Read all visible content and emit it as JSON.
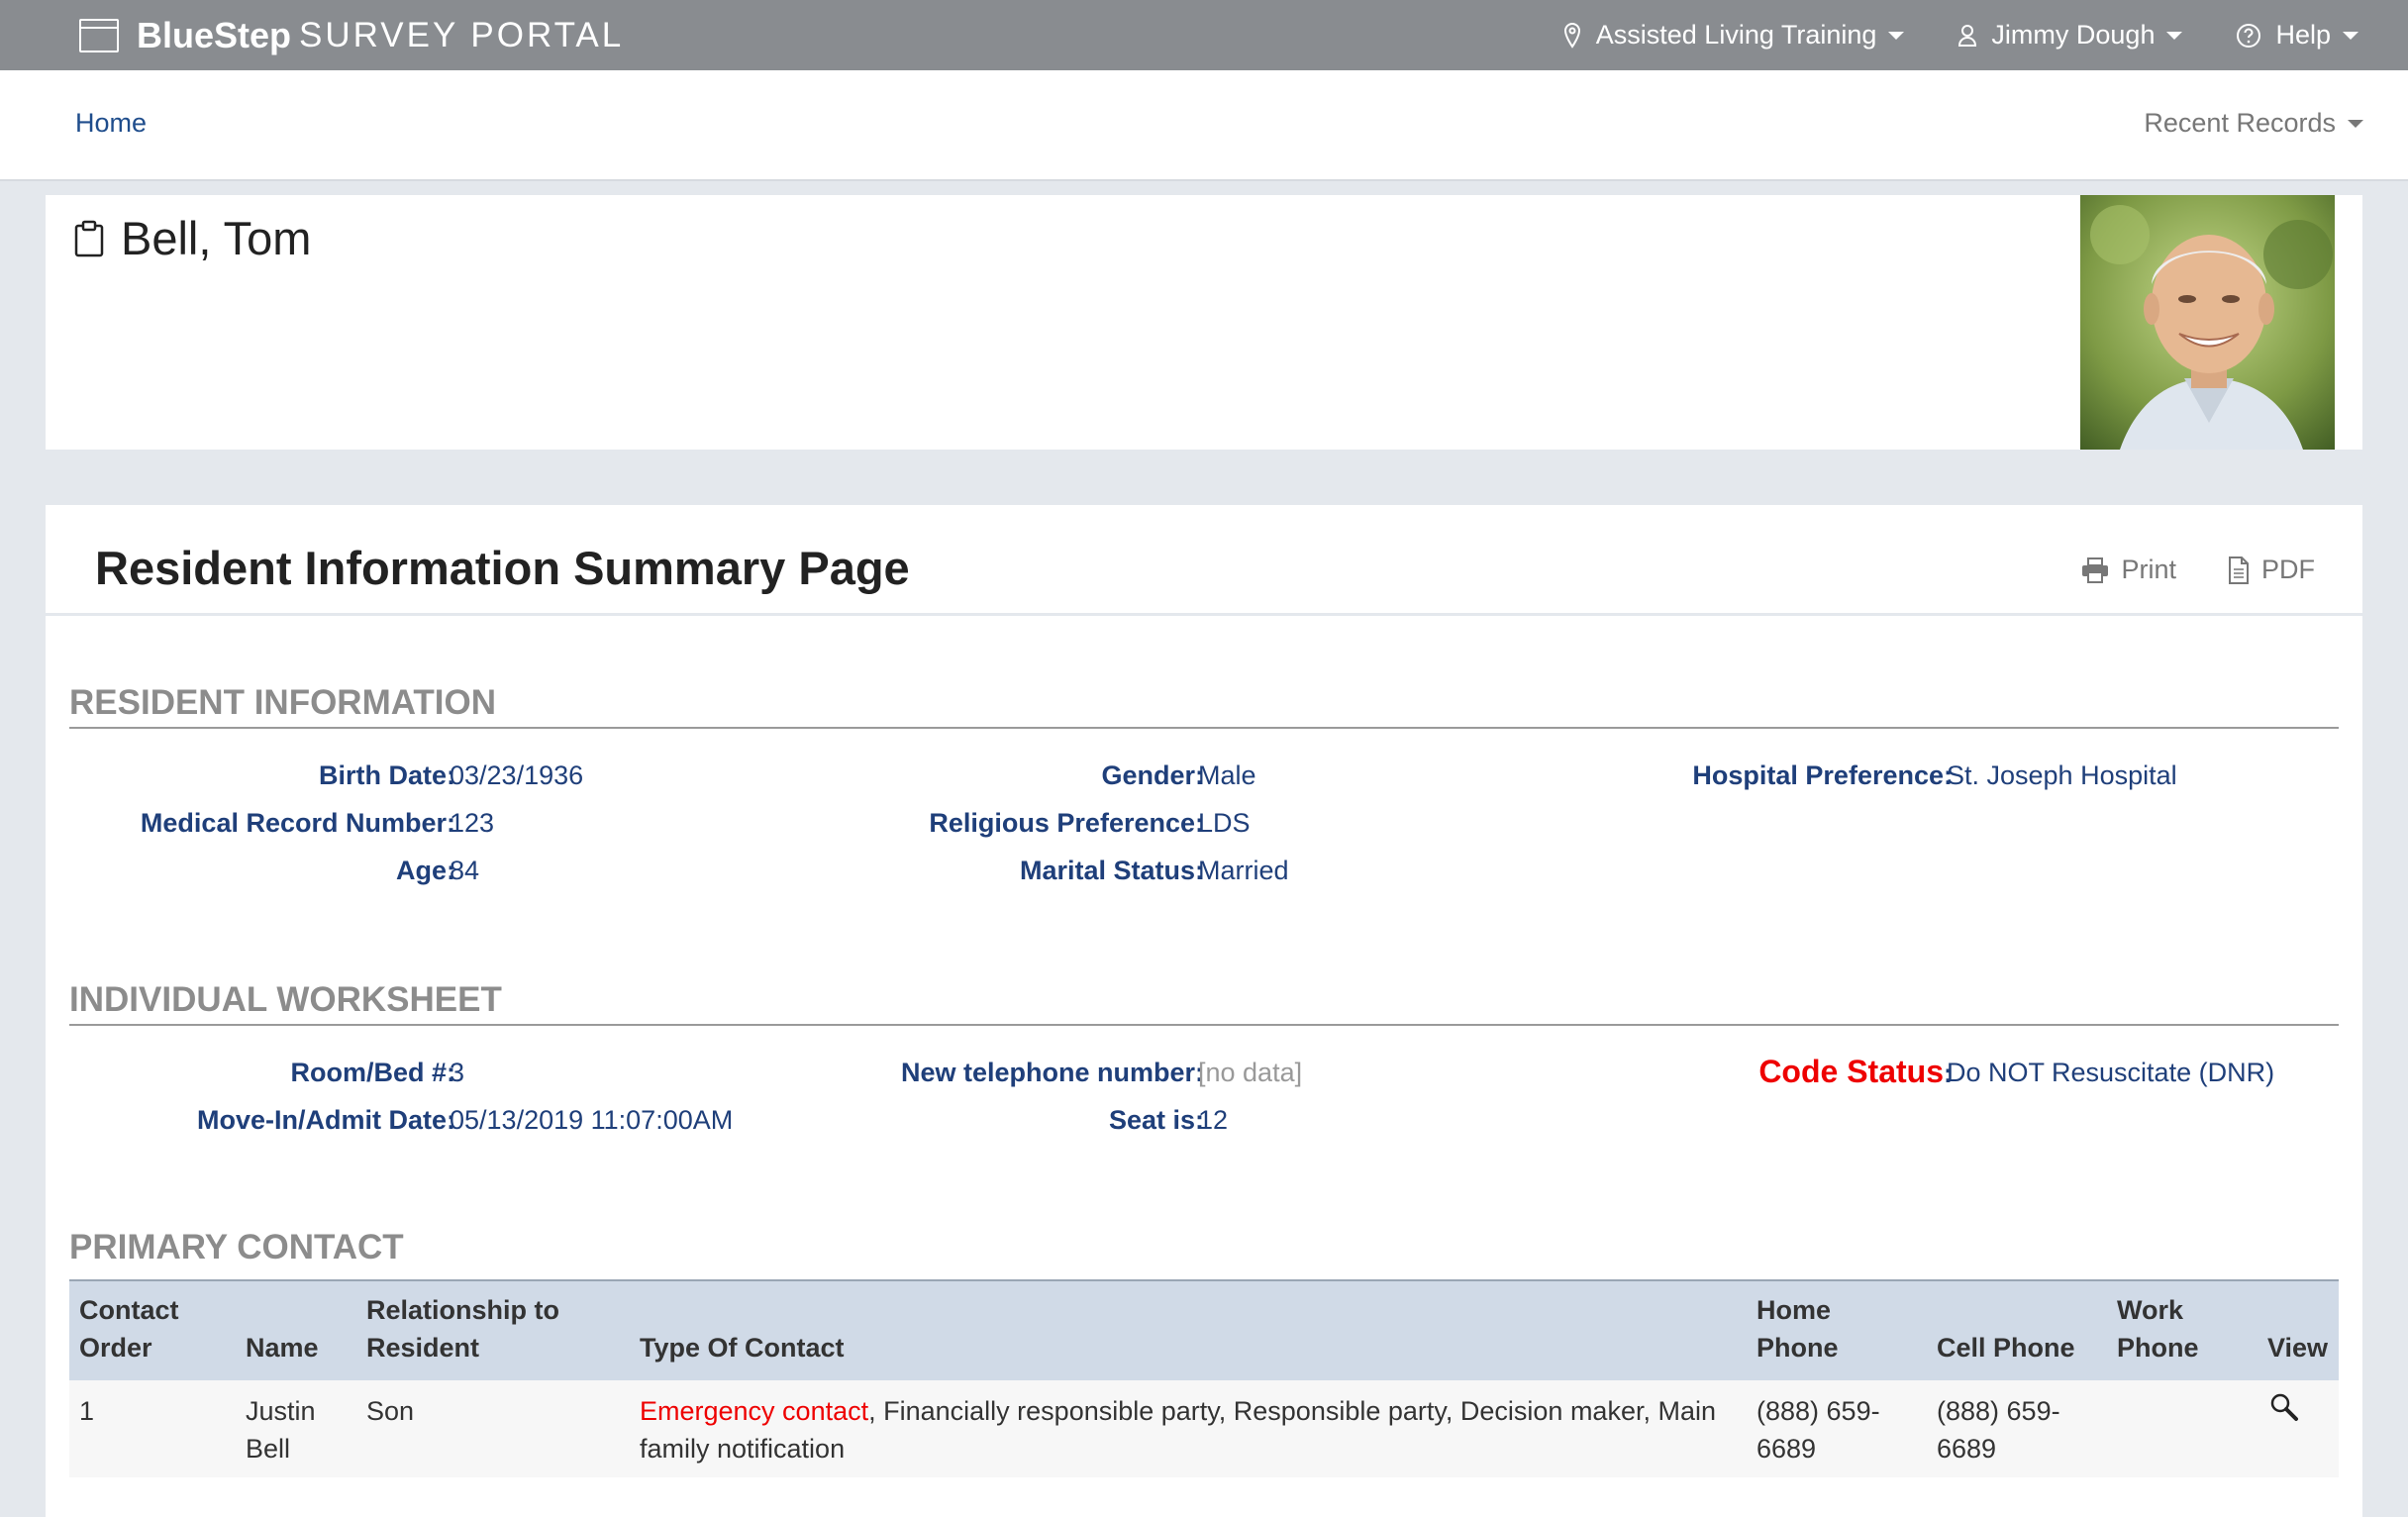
{
  "topbar": {
    "brand_bold": "BlueStep",
    "brand_light": "SURVEY PORTAL",
    "location": "Assisted Living Training",
    "user": "Jimmy Dough",
    "help": "Help"
  },
  "subnav": {
    "home": "Home",
    "recent": "Recent Records"
  },
  "resident": {
    "name": "Bell, Tom"
  },
  "page": {
    "title": "Resident Information Summary Page",
    "print": "Print",
    "pdf": "PDF"
  },
  "resident_info": {
    "heading": "RESIDENT INFORMATION",
    "birth_date_label": "Birth Date:",
    "birth_date": "03/23/1936",
    "mrn_label": "Medical Record Number:",
    "mrn": "123",
    "age_label": "Age:",
    "age": "84",
    "gender_label": "Gender:",
    "gender": "Male",
    "religion_label": "Religious Preference:",
    "religion": "LDS",
    "marital_label": "Marital Status:",
    "marital": "Married",
    "hospital_label": "Hospital Preference:",
    "hospital": "St. Joseph Hospital"
  },
  "worksheet": {
    "heading": "INDIVIDUAL WORKSHEET",
    "room_label": "Room/Bed #:",
    "room": "3",
    "movein_label": "Move-In/Admit Date:",
    "movein": "05/13/2019 11:07:00AM",
    "phone_label": "New telephone number:",
    "phone": "[no data]",
    "seat_label": "Seat is:",
    "seat": "12",
    "code_label": "Code Status",
    "code_colon": ":",
    "code": "Do NOT Resuscitate (DNR)"
  },
  "contact": {
    "heading": "PRIMARY CONTACT",
    "col_order_1": "Contact",
    "col_order_2": "Order",
    "col_name": "Name",
    "col_rel_1": "Relationship to",
    "col_rel_2": "Resident",
    "col_type": "Type Of Contact",
    "col_home": "Home Phone",
    "col_cell": "Cell Phone",
    "col_work_1": "Work",
    "col_work_2": "Phone",
    "col_view": "View",
    "row": {
      "order": "1",
      "name_1": "Justin",
      "name_2": "Bell",
      "relationship": "Son",
      "type_emergency": "Emergency contact",
      "type_rest": ", Financially responsible party, Responsible party, Decision maker, Main family notification",
      "home_1": "(888) 659-",
      "home_2": "6689",
      "cell_1": "(888) 659-",
      "cell_2": "6689",
      "work": ""
    }
  }
}
